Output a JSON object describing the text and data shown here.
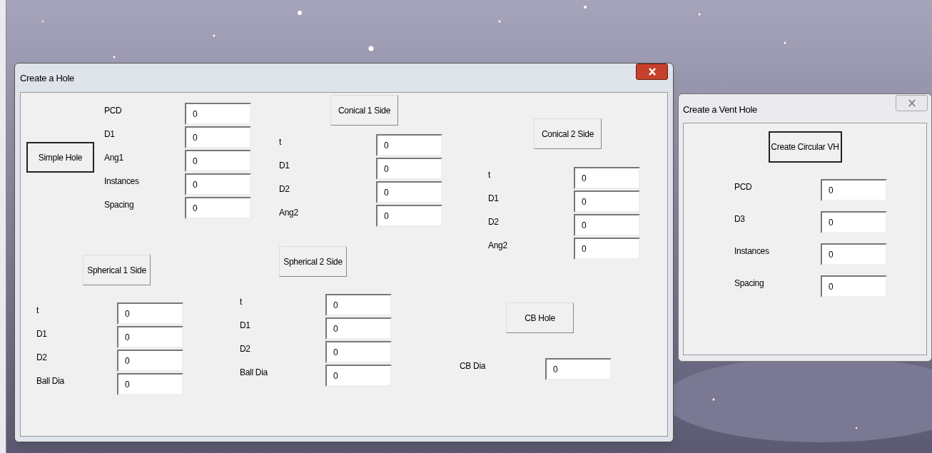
{
  "main_window": {
    "title": "Create a Hole",
    "active": true,
    "groups": [
      {
        "button": {
          "label": "Simple Hole",
          "default": true
        },
        "fields": [
          {
            "label": "PCD",
            "value": "0"
          },
          {
            "label": "D1",
            "value": "0"
          },
          {
            "label": "Ang1",
            "value": "0"
          },
          {
            "label": "Instances",
            "value": "0"
          },
          {
            "label": "Spacing",
            "value": "0"
          }
        ]
      },
      {
        "button": {
          "label": "Conical 1 Side",
          "default": false
        },
        "fields": [
          {
            "label": "t",
            "value": "0"
          },
          {
            "label": "D1",
            "value": "0"
          },
          {
            "label": "D2",
            "value": "0"
          },
          {
            "label": "Ang2",
            "value": "0"
          }
        ]
      },
      {
        "button": {
          "label": "Conical 2 Side",
          "default": false
        },
        "fields": [
          {
            "label": "t",
            "value": "0"
          },
          {
            "label": "D1",
            "value": "0"
          },
          {
            "label": "D2",
            "value": "0"
          },
          {
            "label": "Ang2",
            "value": "0"
          }
        ]
      },
      {
        "button": {
          "label": "Spherical 1 Side",
          "default": false
        },
        "fields": [
          {
            "label": "t",
            "value": "0"
          },
          {
            "label": "D1",
            "value": "0"
          },
          {
            "label": "D2",
            "value": "0"
          },
          {
            "label": "Ball Dia",
            "value": "0"
          }
        ]
      },
      {
        "button": {
          "label": "Spherical 2 Side",
          "default": false
        },
        "fields": [
          {
            "label": "t",
            "value": "0"
          },
          {
            "label": "D1",
            "value": "0"
          },
          {
            "label": "D2",
            "value": "0"
          },
          {
            "label": "Ball Dia",
            "value": "0"
          }
        ]
      },
      {
        "button": {
          "label": "CB Hole",
          "default": false
        },
        "fields": [
          {
            "label": "CB Dia",
            "value": "0"
          }
        ]
      }
    ]
  },
  "vent_window": {
    "title": "Create a Vent Hole",
    "active": false,
    "button": {
      "label": "Create Circular VH",
      "default": true
    },
    "fields": [
      {
        "label": "PCD",
        "value": "0"
      },
      {
        "label": "D3",
        "value": "0"
      },
      {
        "label": "Instances",
        "value": "0"
      },
      {
        "label": "Spacing",
        "value": "0"
      }
    ]
  }
}
